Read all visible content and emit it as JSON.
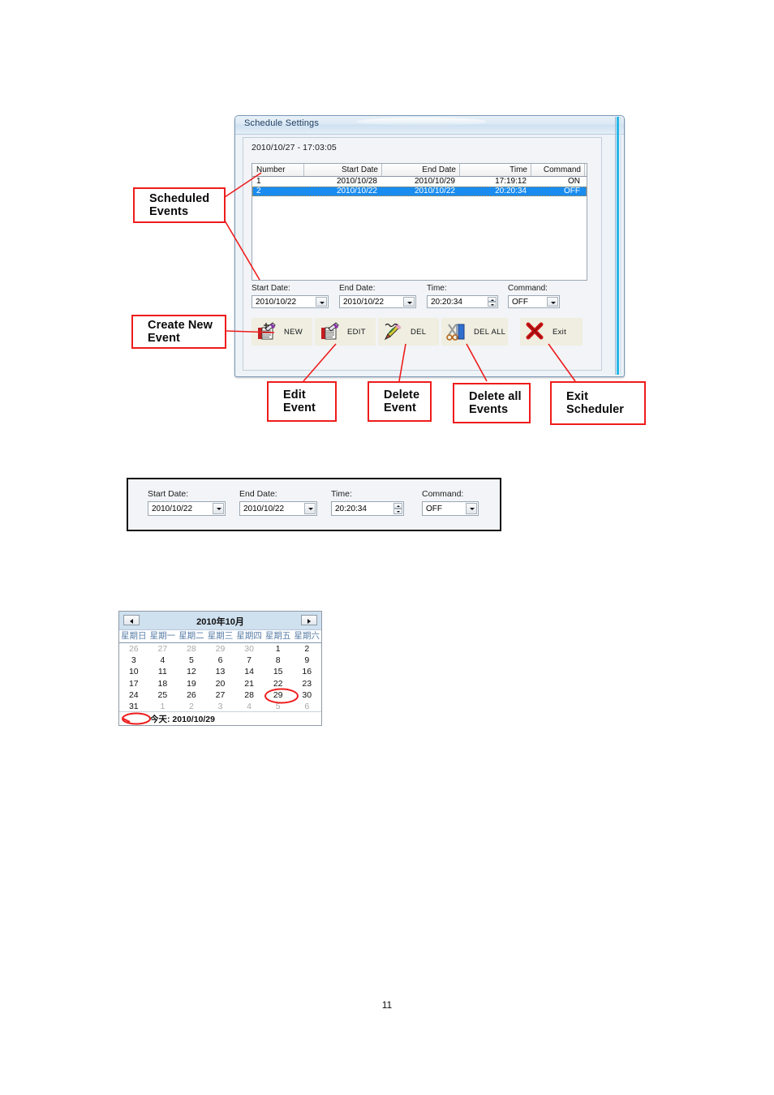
{
  "window": {
    "title": "Schedule Settings",
    "timestamp": "2010/10/27 - 17:03:05",
    "grid": {
      "columns": [
        "Number",
        "Start Date",
        "End Date",
        "Time",
        "Command"
      ],
      "rows": [
        {
          "number": "1",
          "start_date": "2010/10/28",
          "end_date": "2010/10/29",
          "time": "17:19:12",
          "command": "ON",
          "selected": false
        },
        {
          "number": "2",
          "start_date": "2010/10/22",
          "end_date": "2010/10/22",
          "time": "20:20:34",
          "command": "OFF",
          "selected": true
        }
      ]
    },
    "fields": {
      "start_date_label": "Start Date:",
      "start_date_value": "2010/10/22",
      "end_date_label": "End Date:",
      "end_date_value": "2010/10/22",
      "time_label": "Time:",
      "time_value": "20:20:34",
      "command_label": "Command:",
      "command_value": "OFF"
    },
    "toolbar": {
      "new_label": "NEW",
      "edit_label": "EDIT",
      "del_label": "DEL",
      "del_all_label": "DEL ALL",
      "exit_label": "Exit"
    }
  },
  "annotations": {
    "scheduled_events": "Scheduled\nEvents",
    "scheduled_events_l1": "Scheduled",
    "scheduled_events_l2": "Events",
    "create_new_event_l1": "Create New",
    "create_new_event_l2": "Event",
    "edit_event_l1": "Edit",
    "edit_event_l2": "Event",
    "delete_event_l1": "Delete",
    "delete_event_l2": "Event",
    "delete_all_events_l1": "Delete all",
    "delete_all_events_l2": "Events",
    "exit_scheduler_l1": "Exit",
    "exit_scheduler_l2": "Scheduler",
    "line_color": "#ee1c1c"
  },
  "panel2": {
    "start_date_label": "Start Date:",
    "start_date_value": "2010/10/22",
    "end_date_label": "End Date:",
    "end_date_value": "2010/10/22",
    "time_label": "Time:",
    "time_value": "20:20:34",
    "command_label": "Command:",
    "command_value": "OFF"
  },
  "calendar": {
    "month_title": "2010年10月",
    "prev_label": "◄",
    "next_label": "►",
    "weekdays": [
      "星期日",
      "星期一",
      "星期二",
      "星期三",
      "星期四",
      "星期五",
      "星期六"
    ],
    "weeks": [
      [
        {
          "d": "26",
          "dim": true
        },
        {
          "d": "27",
          "dim": true
        },
        {
          "d": "28",
          "dim": true
        },
        {
          "d": "29",
          "dim": true
        },
        {
          "d": "30",
          "dim": true
        },
        {
          "d": "1",
          "dim": false
        },
        {
          "d": "2",
          "dim": false
        }
      ],
      [
        {
          "d": "3",
          "dim": false
        },
        {
          "d": "4",
          "dim": false
        },
        {
          "d": "5",
          "dim": false
        },
        {
          "d": "6",
          "dim": false
        },
        {
          "d": "7",
          "dim": false
        },
        {
          "d": "8",
          "dim": false
        },
        {
          "d": "9",
          "dim": false
        }
      ],
      [
        {
          "d": "10",
          "dim": false
        },
        {
          "d": "11",
          "dim": false
        },
        {
          "d": "12",
          "dim": false
        },
        {
          "d": "13",
          "dim": false
        },
        {
          "d": "14",
          "dim": false
        },
        {
          "d": "15",
          "dim": false
        },
        {
          "d": "16",
          "dim": false
        }
      ],
      [
        {
          "d": "17",
          "dim": false
        },
        {
          "d": "18",
          "dim": false
        },
        {
          "d": "19",
          "dim": false
        },
        {
          "d": "20",
          "dim": false
        },
        {
          "d": "21",
          "dim": false
        },
        {
          "d": "22",
          "dim": false
        },
        {
          "d": "23",
          "dim": false
        }
      ],
      [
        {
          "d": "24",
          "dim": false
        },
        {
          "d": "25",
          "dim": false
        },
        {
          "d": "26",
          "dim": false
        },
        {
          "d": "27",
          "dim": false
        },
        {
          "d": "28",
          "dim": false
        },
        {
          "d": "29",
          "dim": false,
          "selected": true
        },
        {
          "d": "30",
          "dim": false
        }
      ],
      [
        {
          "d": "31",
          "dim": false
        },
        {
          "d": "1",
          "dim": true
        },
        {
          "d": "2",
          "dim": true
        },
        {
          "d": "3",
          "dim": true
        },
        {
          "d": "4",
          "dim": true
        },
        {
          "d": "5",
          "dim": true
        },
        {
          "d": "6",
          "dim": true
        }
      ]
    ],
    "today_text": "今天: 2010/10/29"
  },
  "page_number": "11"
}
